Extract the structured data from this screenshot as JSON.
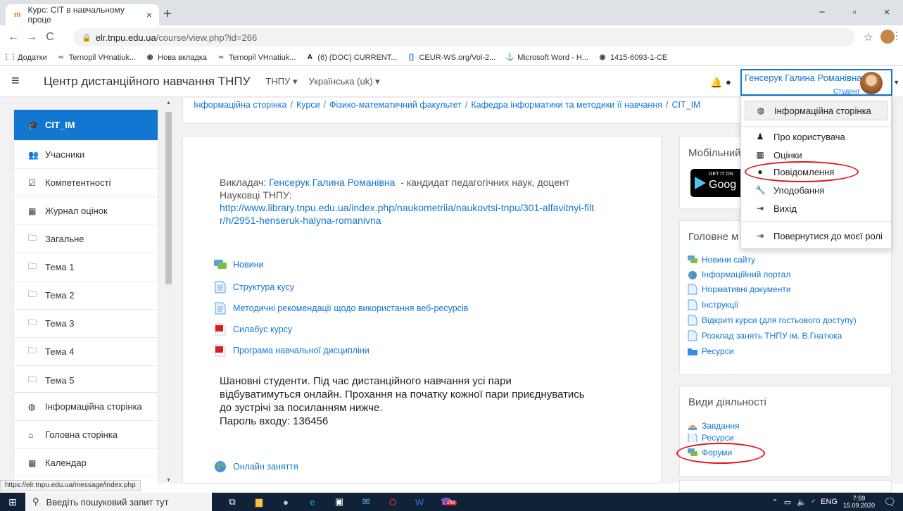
{
  "browser": {
    "tab_title": "Курс: CIT в навчальному проце",
    "tab_close": "×",
    "new_tab": "+",
    "url_host": "elr.tnpu.edu.ua",
    "url_path": "/course/view.php?id=266",
    "window_controls": [
      "−",
      "▫",
      "×"
    ],
    "bookmarks": [
      {
        "label": "Додатки",
        "icon": "apps-grid-icon"
      },
      {
        "label": "Ternopil VHnatiuk...",
        "icon": "cochrane-logo-icon"
      },
      {
        "label": "Нова вкладка",
        "icon": "globe-icon"
      },
      {
        "label": "Ternopil VHnatiuk...",
        "icon": "cochrane-logo-icon"
      },
      {
        "label": "(6) (DOC) CURRENT...",
        "icon": "academia-logo-icon"
      },
      {
        "label": "CEUR-WS.org/Vol-2...",
        "icon": "ceur-logo-icon"
      },
      {
        "label": "Microsoft Word - H...",
        "icon": "pdf-icon"
      },
      {
        "label": "1415-6093-1-CE",
        "icon": "globe-icon"
      }
    ]
  },
  "navbar": {
    "site_name": "Центр дистанційного навчання ТНПУ",
    "menu1": "ТНПУ ▾",
    "menu2": "Українська (uk) ▾",
    "user_name": "Генсерук Галина Романівна",
    "user_role": "Студент"
  },
  "drawer": {
    "items": [
      {
        "label": "CIT_IM",
        "icon": "graduation-cap-icon",
        "active": true
      },
      {
        "label": "Учасники",
        "icon": "users-icon"
      },
      {
        "label": "Компетентності",
        "icon": "checkbox-icon"
      },
      {
        "label": "Журнал оцінок",
        "icon": "table-icon"
      },
      {
        "label": "Загальне",
        "icon": "folder-icon"
      },
      {
        "label": "Тема 1",
        "icon": "folder-icon"
      },
      {
        "label": "Тема 2",
        "icon": "folder-icon"
      },
      {
        "label": "Тема 3",
        "icon": "folder-icon"
      },
      {
        "label": "Тема 4",
        "icon": "folder-icon"
      },
      {
        "label": "Тема 5",
        "icon": "folder-icon"
      }
    ],
    "items2": [
      {
        "label": "Інформаційна сторінка",
        "icon": "tachometer-icon"
      },
      {
        "label": "Головна сторінка",
        "icon": "home-icon"
      },
      {
        "label": "Календар",
        "icon": "calendar-icon"
      }
    ]
  },
  "breadcrumb": [
    "Інформаційна сторінка",
    "Курси",
    "Фізико-математичний факультет",
    "Кафедра інформатики та методики її навчання",
    "CIT_IM"
  ],
  "main": {
    "teacher_prefix": "Викладач: ",
    "teacher_name": "Генсерук Галина Романівна",
    "teacher_suffix": "  - кандидат педагогічних наук, доцент",
    "scholars_label": "Науковці ТНПУ:",
    "scholars_link": "http://www.library.tnpu.edu.ua/index.php/naukometriia/naukovtsi-tnpu/301-alfavitnyi-filtr/h/2951-henseruk-halyna-romanivna",
    "activities": [
      {
        "label": "Новини",
        "icon": "forum-icon"
      },
      {
        "label": "Структура кусу",
        "icon": "page-icon"
      },
      {
        "label": "Методичні рекомендації щодо використання веб-ресурсів",
        "icon": "page-icon"
      },
      {
        "label": "Силабус курсу",
        "icon": "pdf-icon"
      },
      {
        "label": "Програма навчальної дисципліни",
        "icon": "pdf-icon"
      }
    ],
    "notice_line1": "Шановні студенти. Під час дистанційного навчання усі пари",
    "notice_line2": "відбуватимуться онлайн. Прохання на початку кожної пари приєднуватись",
    "notice_line3": "до зустрічі за посиланням нижче.",
    "notice_line4": "Пароль входу: 136456",
    "online": {
      "label": "Онлайн заняття",
      "icon": "url-globe-icon"
    }
  },
  "blocks": {
    "mobile_title": "Мобільний",
    "gplay_top": "GET IT ON",
    "gplay_bottom": "Goog",
    "mainmenu_title": "Головне м",
    "mainmenu_links": [
      {
        "label": "Новини сайту",
        "icon": "forum-icon"
      },
      {
        "label": "Інформаційний портал",
        "icon": "url-globe-icon"
      },
      {
        "label": "Нормативні документи",
        "icon": "page-icon"
      },
      {
        "label": "Інструкції",
        "icon": "page-icon"
      },
      {
        "label": "Відкриті курси (для гостьового доступу)",
        "icon": "page-icon"
      },
      {
        "label": "Розклад занять ТНПУ ім. В.Гнатюка",
        "icon": "page-icon"
      },
      {
        "label": "Ресурси",
        "icon": "folder-icon"
      }
    ],
    "activities_title": "Види діяльності",
    "activities_links": [
      {
        "label": "Завдання",
        "icon": "assignment-icon"
      },
      {
        "label": "Ресурси",
        "icon": "page-icon"
      },
      {
        "label": "Форуми",
        "icon": "forum-icon"
      }
    ]
  },
  "usermenu": {
    "items": [
      {
        "label": "Інформаційна сторінка",
        "icon": "tachometer-icon"
      },
      {
        "label": "Про користувача",
        "icon": "user-icon"
      },
      {
        "label": "Оцінки",
        "icon": "table-icon"
      },
      {
        "label": "Повідомлення",
        "icon": "comment-icon"
      },
      {
        "label": "Уподобання",
        "icon": "wrench-icon"
      },
      {
        "label": "Вихід",
        "icon": "sign-out-icon"
      },
      {
        "label": "Повернутися до моєї ролі",
        "icon": "sign-out-icon"
      }
    ]
  },
  "status_url": "https://elr.tnpu.edu.ua/message/index.php",
  "taskbar": {
    "search_placeholder": "Введіть пошуковий запит тут",
    "badge": "248",
    "lang": "ENG",
    "time": "7:59",
    "date": "15.09.2020"
  },
  "colors": {
    "accent": "#1177d1",
    "highlight_ring": "#e0171e",
    "taskbar": "#0f2238"
  }
}
